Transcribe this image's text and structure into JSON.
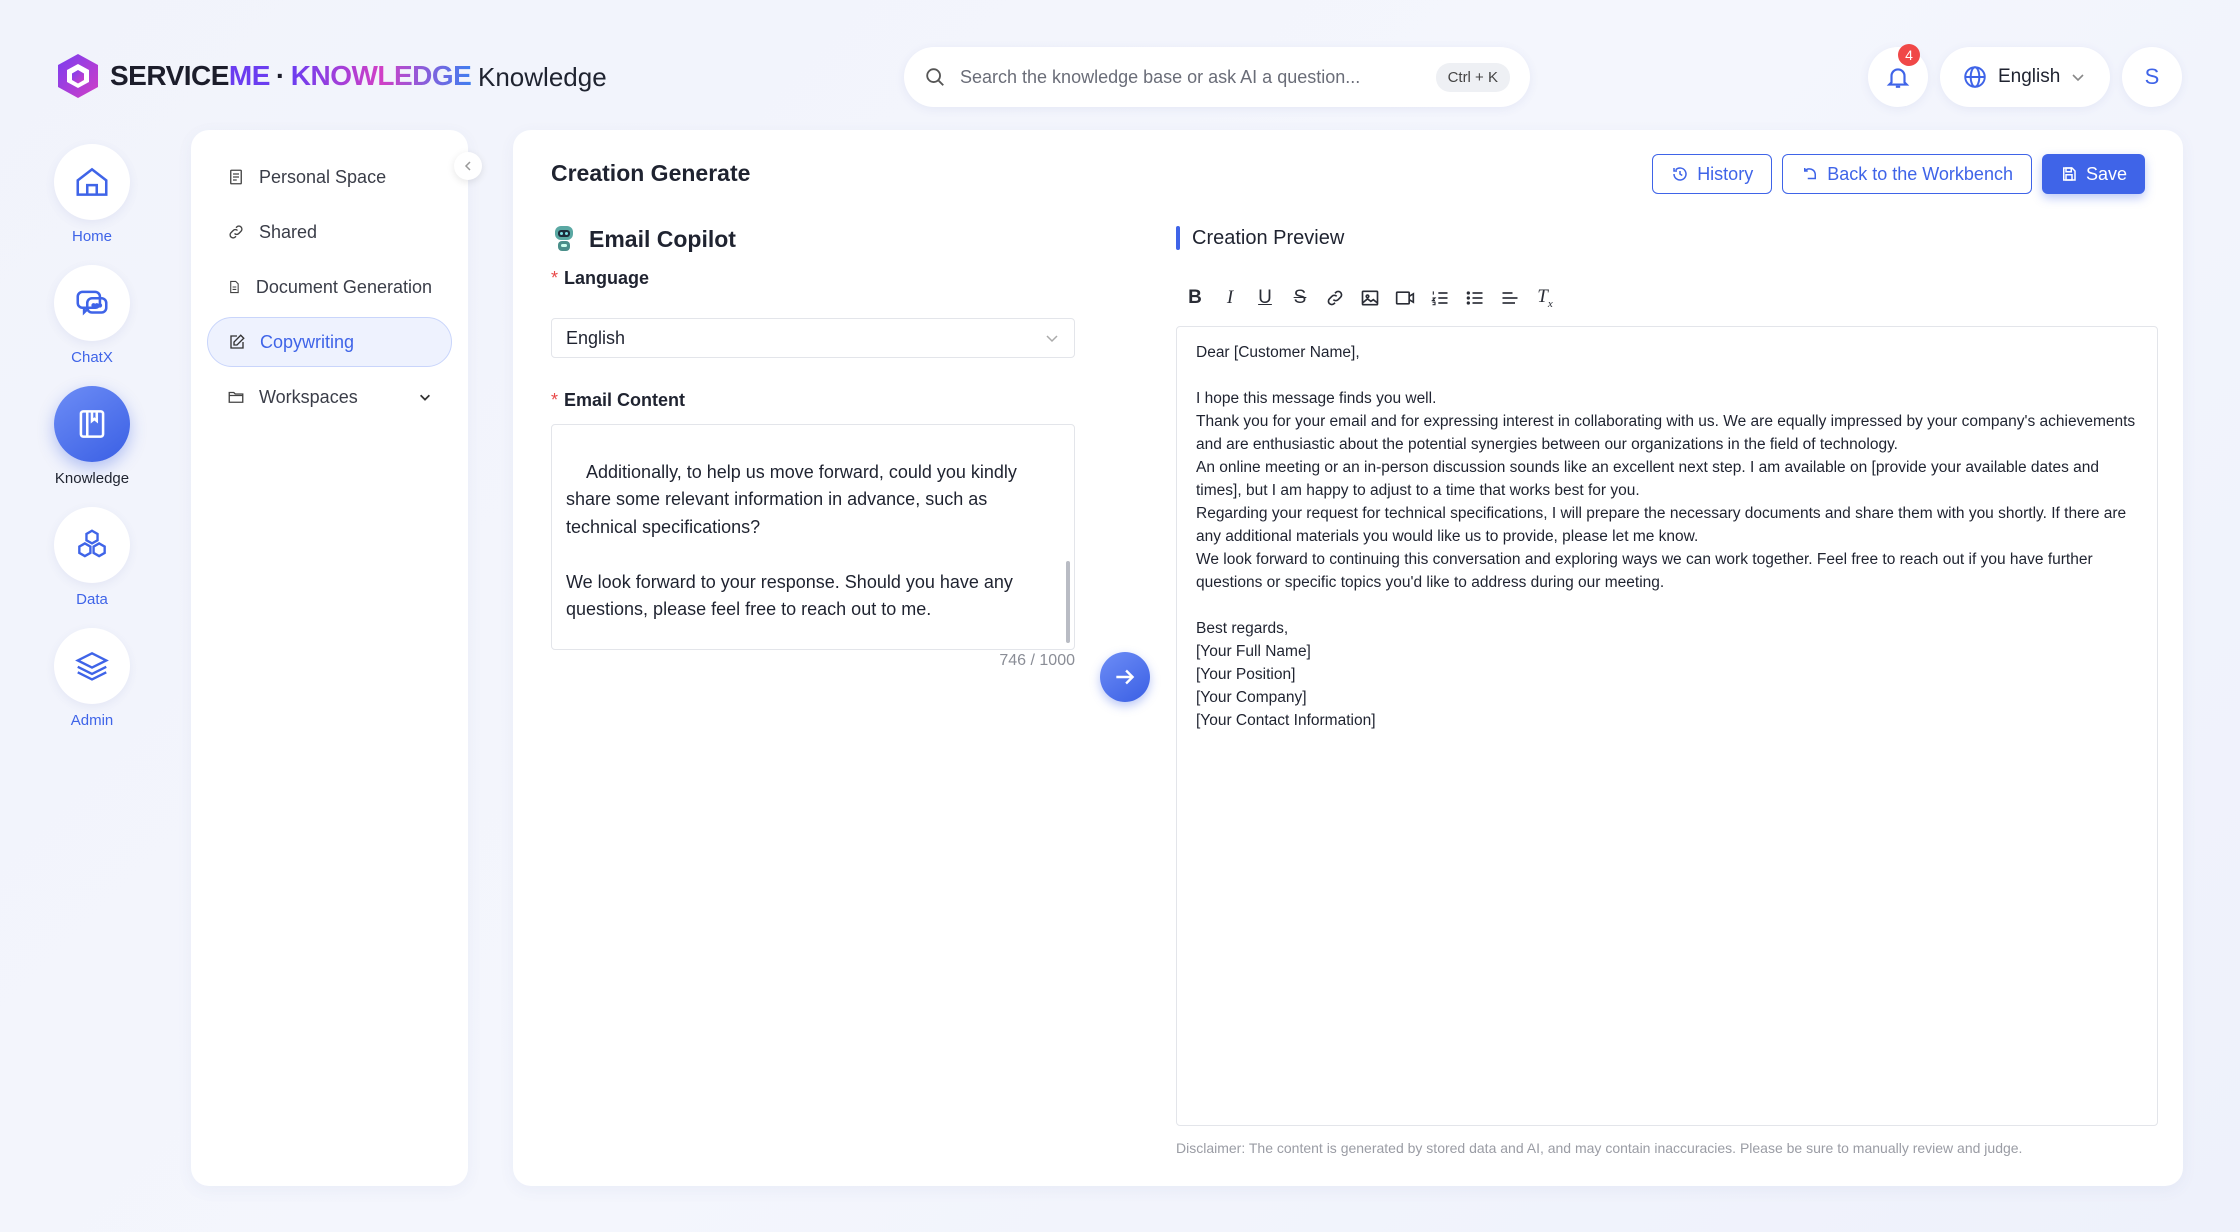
{
  "header": {
    "logo": {
      "part1": "SERVICE",
      "part2": "ME",
      "sep": "·",
      "part3": "KNOWLEDGE"
    },
    "app_title": "Knowledge",
    "search": {
      "placeholder": "Search the knowledge base or ask AI a question...",
      "shortcut": "Ctrl + K"
    },
    "notifications": {
      "count": "4"
    },
    "language": "English",
    "avatar_initial": "S"
  },
  "rail": {
    "items": [
      {
        "label": "Home",
        "icon": "home-icon"
      },
      {
        "label": "ChatX",
        "icon": "chat-icon"
      },
      {
        "label": "Knowledge",
        "icon": "book-icon",
        "active": true
      },
      {
        "label": "Data",
        "icon": "hexagons-icon"
      },
      {
        "label": "Admin",
        "icon": "layers-icon"
      }
    ]
  },
  "sidenav": {
    "items": [
      {
        "label": "Personal Space",
        "icon": "document-icon"
      },
      {
        "label": "Shared",
        "icon": "link-icon"
      },
      {
        "label": "Document Generation",
        "icon": "file-icon"
      },
      {
        "label": "Copywriting",
        "icon": "edit-icon",
        "active": true
      },
      {
        "label": "Workspaces",
        "icon": "folder-icon"
      }
    ]
  },
  "main": {
    "title": "Creation Generate",
    "actions": {
      "history": "History",
      "back": "Back to the Workbench",
      "save": "Save"
    },
    "copilot_title": "Email Copilot",
    "language_label": "Language",
    "language_value": "English",
    "email_label": "Email Content",
    "email_content": "Additionally, to help us move forward, could you kindly share some relevant information in advance, such as technical specifications?\n\nWe look forward to your response. Should you have any questions, please feel free to reach out to me.\n\nBest regards,",
    "counter": "746 / 1000",
    "preview_title": "Creation Preview",
    "preview_lines": [
      "Dear [Customer Name],",
      "",
      "I hope this message finds you well.",
      "Thank you for your email and for expressing interest in collaborating with us. We are equally impressed by your company's achievements and are enthusiastic about the potential synergies between our organizations in the field of technology.",
      "An online meeting or an in-person discussion sounds like an excellent next step. I am available on [provide your available dates and times], but I am happy to adjust to a time that works best for you.",
      "Regarding your request for technical specifications, I will prepare the necessary documents and share them with you shortly. If there are any additional materials you would like us to provide, please let me know.",
      "We look forward to continuing this conversation and exploring ways we can work together. Feel free to reach out if you have further questions or specific topics you'd like to address during our meeting.",
      "",
      "Best regards,",
      "[Your Full Name]",
      "[Your Position]",
      "[Your Company]",
      "[Your Contact Information]"
    ],
    "disclaimer": "Disclaimer: The content is generated by stored data and AI, and may contain inaccuracies. Please be sure to manually review and judge."
  },
  "colors": {
    "accent": "#3f64e8",
    "badge": "#f04848",
    "required": "#e84848"
  }
}
